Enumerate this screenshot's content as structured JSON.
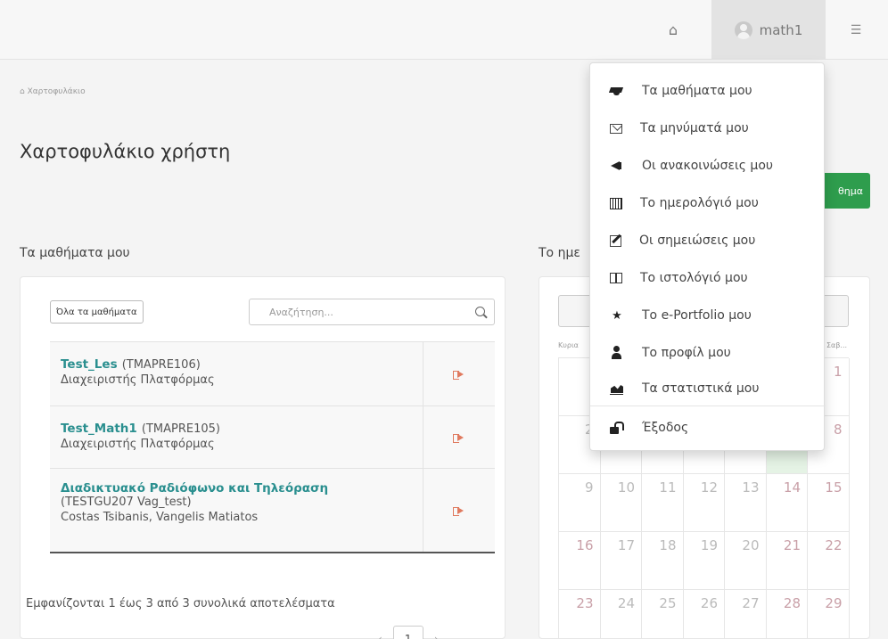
{
  "topbar": {
    "home_icon": "home-icon",
    "username": "math1",
    "settings_icon": "sliders-icon"
  },
  "breadcrumb": "Χαρτοφυλάκιο",
  "page_title": "Χαρτοφυλάκιο χρήστη",
  "partial_button_label": "θημα",
  "courses": {
    "heading": "Τα μαθήματα μου",
    "all_courses_label": "Όλα τα μαθήματα",
    "search_placeholder": "Αναζήτηση...",
    "rows": [
      {
        "title": "Test_Les",
        "code": "(TMAPRE106)",
        "subtitle": "Διαχειριστής Πλατφόρμας"
      },
      {
        "title": "Test_Math1",
        "code": "(TMAPRE105)",
        "subtitle": "Διαχειριστής Πλατφόρμας"
      },
      {
        "title": "Διαδικτυακό Ραδιόφωνο και Τηλεόραση",
        "code": "(TESTGU207 Vag_test)",
        "subtitle": "Costas Tsibanis, Vangelis Matiatos"
      }
    ],
    "result_info": "Εμφανίζονται 1 έως 3 από 3 συνολικά αποτελέσματα",
    "pager": {
      "prev": "‹",
      "current": "1",
      "next": "›"
    }
  },
  "calendar": {
    "heading_partial": "Το ημε",
    "weekday_first": "Κυρια",
    "weekday_last": "Σαβ...",
    "rows": [
      [
        "",
        "",
        "",
        "",
        "",
        "",
        "1"
      ],
      [
        "2",
        "",
        "",
        "",
        "",
        "",
        "8"
      ],
      [
        "9",
        "10",
        "11",
        "12",
        "13",
        "14",
        "15"
      ],
      [
        "16",
        "17",
        "18",
        "19",
        "20",
        "21",
        "22"
      ],
      [
        "23",
        "24",
        "25",
        "26",
        "27",
        "28",
        "29"
      ]
    ]
  },
  "user_menu": {
    "items": [
      {
        "label": "Τα μαθήματα μου",
        "icon": "graduation-cap-icon"
      },
      {
        "label": "Τα μηνύματά μου",
        "icon": "envelope-icon"
      },
      {
        "label": "Οι ανακοινώσεις μου",
        "icon": "bullhorn-icon"
      },
      {
        "label": "Το ημερολόγιό μου",
        "icon": "calendar-icon"
      },
      {
        "label": "Οι σημειώσεις μου",
        "icon": "edit-icon"
      },
      {
        "label": "Το ιστολόγιό μου",
        "icon": "blog-icon"
      },
      {
        "label": "Το e-Portfolio μου",
        "icon": "star-icon"
      },
      {
        "label": "Το προφίλ μου",
        "icon": "user-icon"
      },
      {
        "label": "Τα στατιστικά μου",
        "icon": "area-chart-icon"
      },
      {
        "label": "Έξοδος",
        "icon": "unlock-icon"
      }
    ]
  },
  "colors": {
    "accent_teal": "#2a8f8f",
    "green_button": "#2e9d4d",
    "enter_icon": "#e07a5f"
  }
}
